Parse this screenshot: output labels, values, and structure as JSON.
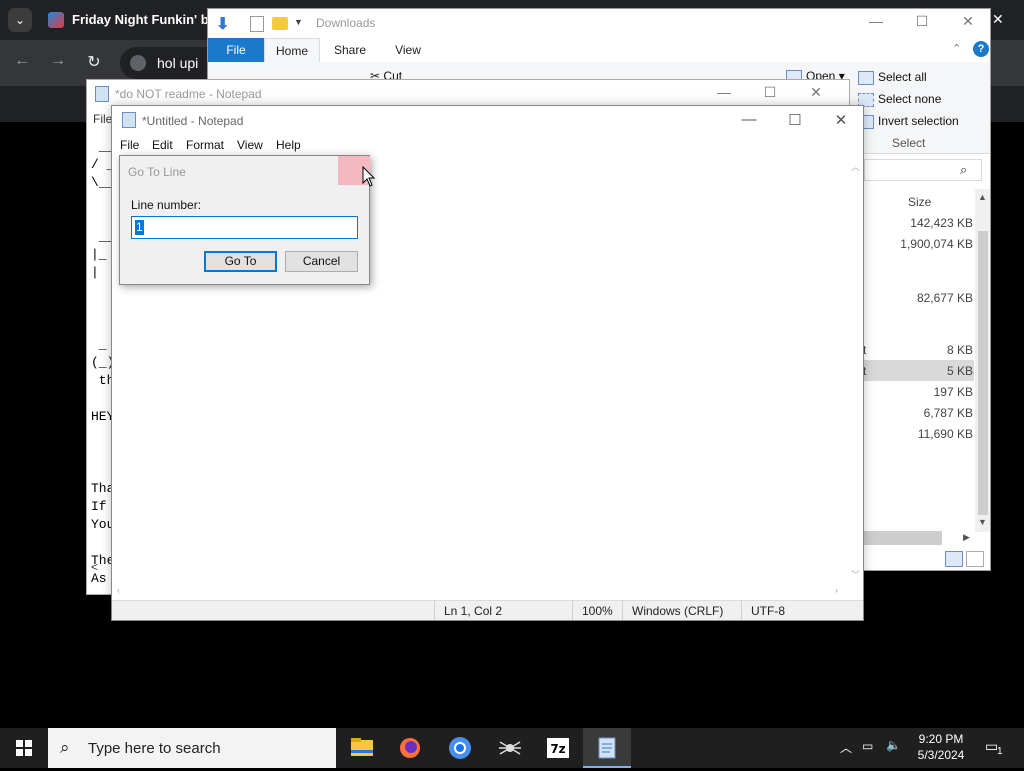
{
  "chrome": {
    "tab_title": "Friday Night Funkin' by r",
    "omnibox_text": "hol upi",
    "menu_icon": "chevron-down-icon",
    "close_glyph": "✕"
  },
  "explorer": {
    "title": "Downloads",
    "tabs": [
      "File",
      "Home",
      "Share",
      "View"
    ],
    "ribbon": {
      "cut_label": "Cut",
      "open_label": "Open ▾",
      "select_all": "Select all",
      "select_none": "Select none",
      "invert_selection": "Invert selection",
      "group_label": "Select"
    },
    "column_size": "Size",
    "rows": [
      {
        "frag": "",
        "size": "142,423 KB"
      },
      {
        "frag": "",
        "size": "1,900,074 KB"
      },
      {
        "frag": "",
        "size": "82,677 KB"
      },
      {
        "frag": "t",
        "size": "8 KB"
      },
      {
        "frag": "t",
        "size": "5 KB"
      },
      {
        "frag": "",
        "size": "197 KB"
      },
      {
        "frag": "",
        "size": "6,787 KB"
      },
      {
        "frag": "",
        "size": "11,690 KB"
      }
    ]
  },
  "notepad_back": {
    "title": "*do NOT readme - Notepad",
    "menu_file": "File",
    "lines": [
      " __",
      "/ _",
      "\\__",
      "",
      "",
      " __",
      "|_",
      "|",
      "",
      "",
      "",
      " _",
      "(_)",
      " th",
      "",
      "HEY",
      "",
      "",
      "",
      "Tha",
      "If ",
      "You",
      "",
      "The",
      "As "
    ],
    "scroll_left": "<"
  },
  "notepad": {
    "title": "*Untitled - Notepad",
    "menu": {
      "file": "File",
      "edit": "Edit",
      "format": "Format",
      "view": "View",
      "help": "Help"
    },
    "status": {
      "position": "Ln 1, Col 2",
      "zoom": "100%",
      "line_ending": "Windows (CRLF)",
      "encoding": "UTF-8"
    }
  },
  "goto_dialog": {
    "title": "Go To Line",
    "label": "Line number:",
    "value": "1",
    "ok_label": "Go To",
    "cancel_label": "Cancel"
  },
  "taskbar": {
    "search_placeholder": "Type here to search",
    "time": "9:20 PM",
    "date": "5/3/2024",
    "notification_count": "1",
    "apps": [
      "file-explorer-icon",
      "firefox-icon",
      "chrome-icon",
      "spider-icon",
      "7zip-icon",
      "notepad-icon"
    ]
  },
  "colors": {
    "accent": "#0078d7",
    "ribbon_file": "#1979ca",
    "taskbar": "#1f1f1f",
    "chrome_bg": "#202124"
  }
}
